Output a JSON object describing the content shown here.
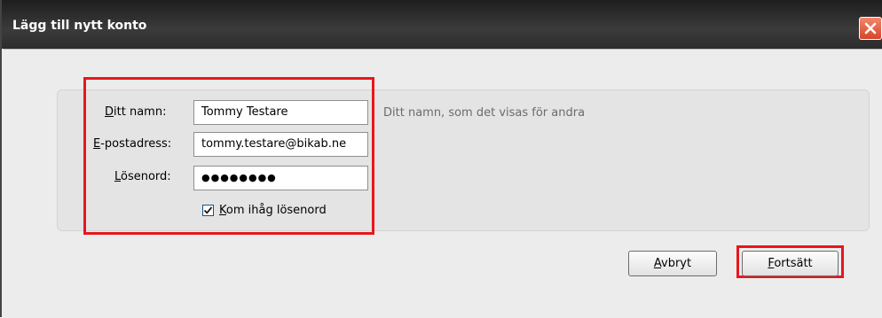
{
  "window": {
    "title": "Lägg till nytt konto"
  },
  "form": {
    "name": {
      "label_first": "D",
      "label_rest": "itt namn:",
      "value": "Tommy Testare",
      "hint": "Ditt namn, som det visas för andra"
    },
    "email": {
      "label_first": "E",
      "label_rest": "-postadress:",
      "value": "tommy.testare@bikab.ne"
    },
    "password": {
      "label_first": "L",
      "label_rest": "ösenord:",
      "value": "●●●●●●●●"
    },
    "remember": {
      "label_first": "K",
      "label_rest": "om ihåg lösenord",
      "checked": true
    }
  },
  "buttons": {
    "cancel_first": "A",
    "cancel_rest": "vbryt",
    "continue_first": "F",
    "continue_rest": "ortsätt"
  },
  "colors": {
    "highlight": "#e8161e",
    "titlebar": "#2c2c2c",
    "close": "#d6452a"
  }
}
